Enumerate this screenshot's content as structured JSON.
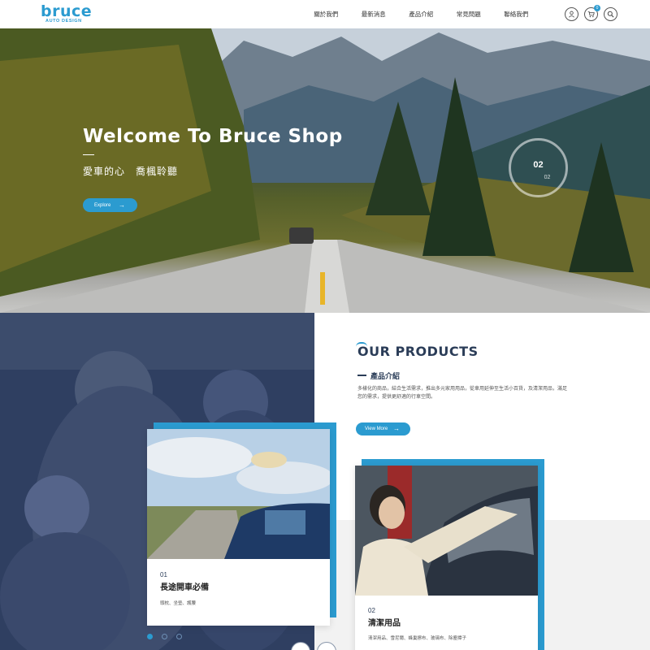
{
  "brand": {
    "logo_main": "bruce",
    "logo_sub": "AUTO DESIGN"
  },
  "nav": {
    "items": [
      "關於我們",
      "最新消息",
      "產品介紹",
      "常見問題",
      "聯絡我們"
    ]
  },
  "header_icons": {
    "account": "user-icon",
    "cart": "cart-icon",
    "cart_count": "0",
    "search": "search-icon"
  },
  "hero": {
    "title": "Welcome To Bruce Shop",
    "subtitle": "愛車的心　喬楓聆聽",
    "button": "Explore",
    "slide_current": "02",
    "slide_total": "02"
  },
  "products": {
    "heading": "OUR PRODUCTS",
    "subheading": "產品介紹",
    "description": "多樣化的商品，結合生活需求，推出多元家用用品，從車用延伸至生活小百貨，及清潔用品，滿足您的需求，提供更舒適的行車空間。",
    "button": "View More"
  },
  "cards": [
    {
      "num": "01",
      "title": "長途開車必備",
      "tags": "頭枕、坐墊、護腰"
    },
    {
      "num": "02",
      "title": "清潔用品",
      "tags": "清潔用品、雪尼爾、蜂巢擦布、玻璃布、除塵撢子"
    }
  ],
  "colors": {
    "accent": "#2b9bd0",
    "navy": "#2b3d58",
    "overlay": "#2f3f61"
  }
}
